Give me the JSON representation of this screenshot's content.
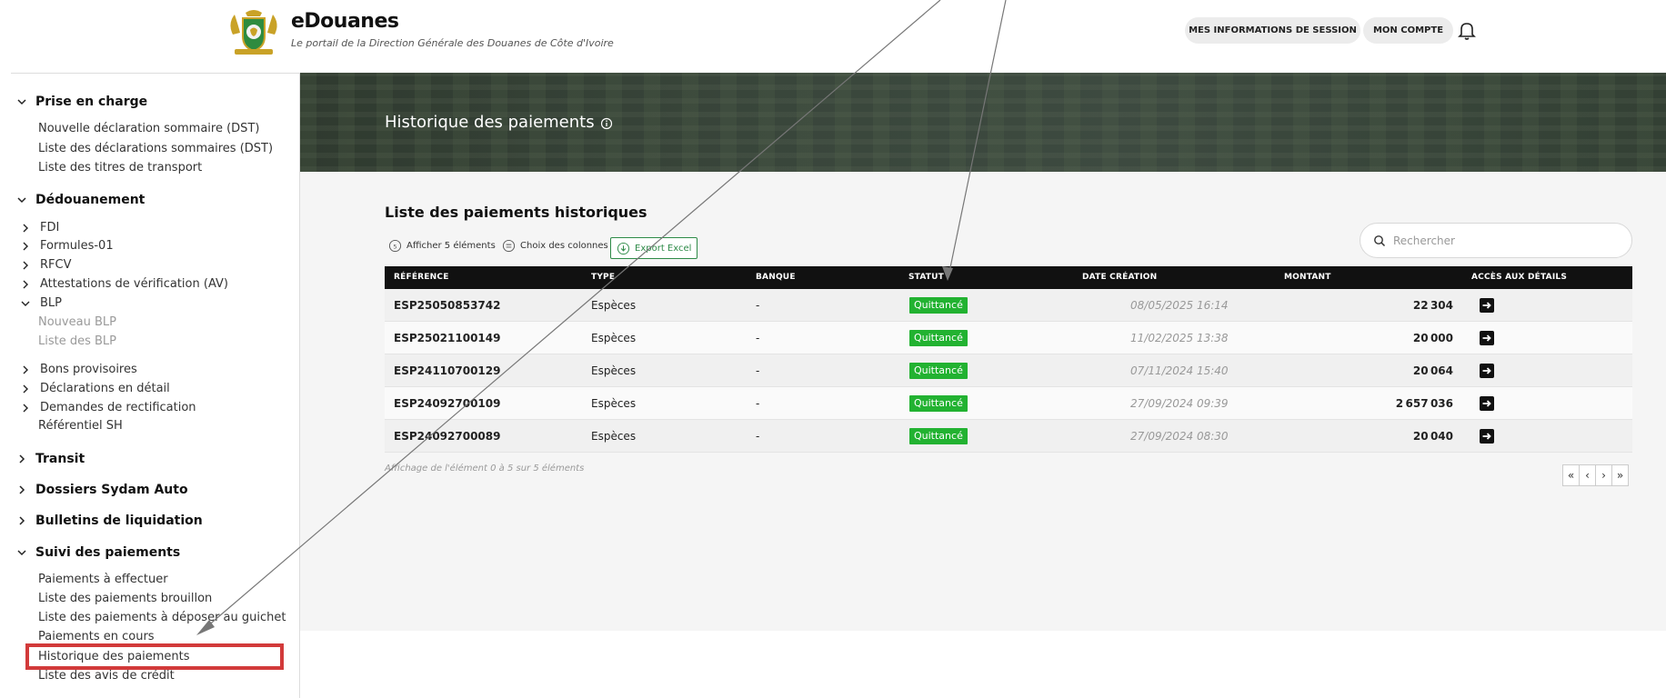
{
  "header": {
    "title": "eDouanes",
    "subtitle": "Le portail de la Direction Générale des Douanes de Côte d'Ivoire",
    "session_button": "MES INFORMATIONS DE SESSION",
    "account_button": "MON COMPTE",
    "bell_icon": "bell-icon"
  },
  "sidebar": {
    "prise_en_charge": {
      "label": "Prise en charge",
      "items": [
        "Nouvelle déclaration sommaire (DST)",
        "Liste des déclarations sommaires (DST)",
        "Liste des titres de transport"
      ]
    },
    "dedouanement": {
      "label": "Dédouanement",
      "items": [
        "FDI",
        "Formules-01",
        "RFCV",
        "Attestations de vérification (AV)",
        "BLP"
      ],
      "blp_items": [
        "Nouveau BLP",
        "Liste des BLP"
      ],
      "more_items": [
        "Bons provisoires",
        "Déclarations en détail",
        "Demandes de rectification",
        "Référentiel SH"
      ]
    },
    "transit": "Transit",
    "dossiers": "Dossiers Sydam Auto",
    "bulletins": "Bulletins de liquidation",
    "suivi": {
      "label": "Suivi des paiements",
      "items": [
        "Paiements à effectuer",
        "Liste des paiements brouillon",
        "Liste des paiements à déposer au guichet",
        "Paiements en cours",
        "Historique des paiements",
        "Liste des avis de crédit"
      ]
    },
    "highlight_color": "#d23a3a"
  },
  "banner": {
    "title": "Historique des paiements"
  },
  "main": {
    "list_title": "Liste des paiements historiques",
    "tools": {
      "show": "Afficher 5 éléments",
      "columns": "Choix des colonnes",
      "export": "Export Excel"
    },
    "search": {
      "placeholder": "Rechercher"
    },
    "columns": [
      "RÉFÉRENCE",
      "TYPE",
      "BANQUE",
      "STATUT",
      "DATE CRÉATION",
      "MONTANT",
      "ACCÈS AUX DÉTAILS"
    ],
    "rows": [
      {
        "ref": "ESP25050853742",
        "type": "Espèces",
        "bank": "-",
        "status": "Quittancé",
        "date": "08/05/2025 16:14",
        "amount": "22304"
      },
      {
        "ref": "ESP25021100149",
        "type": "Espèces",
        "bank": "-",
        "status": "Quittancé",
        "date": "11/02/2025 13:38",
        "amount": "20000"
      },
      {
        "ref": "ESP24110700129",
        "type": "Espèces",
        "bank": "-",
        "status": "Quittancé",
        "date": "07/11/2024 15:40",
        "amount": "20064"
      },
      {
        "ref": "ESP24092700109",
        "type": "Espèces",
        "bank": "-",
        "status": "Quittancé",
        "date": "27/09/2024 09:39",
        "amount": "2657036"
      },
      {
        "ref": "ESP24092700089",
        "type": "Espèces",
        "bank": "-",
        "status": "Quittancé",
        "date": "27/09/2024 08:30",
        "amount": "20040"
      }
    ],
    "info": "Affichage de l'élément 0 à 5 sur 5 éléments",
    "pager": [
      "«",
      "‹",
      "›",
      "»"
    ],
    "status_color": "#22b231"
  }
}
